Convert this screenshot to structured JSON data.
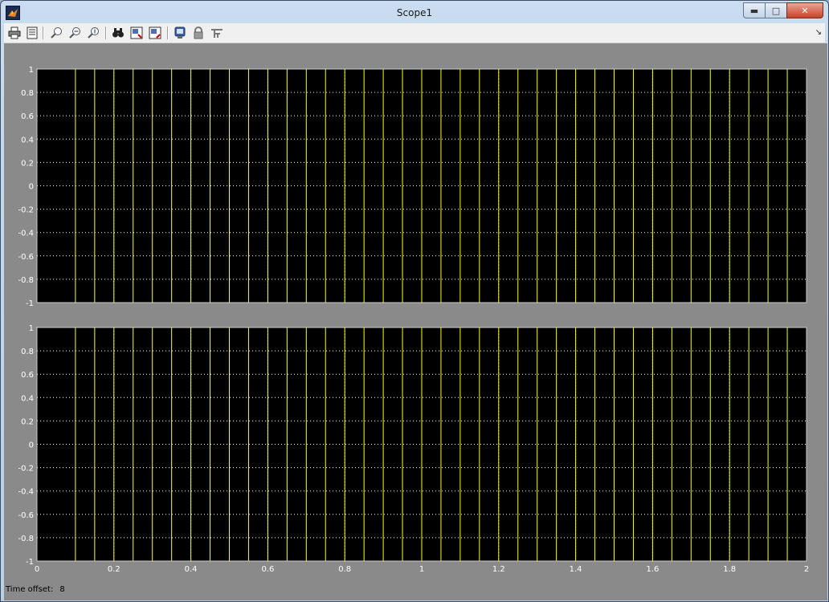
{
  "window": {
    "title": "Scope1"
  },
  "toolbar": {
    "icons": [
      "print-icon",
      "parameters-icon",
      "zoom-icon",
      "zoom-x-icon",
      "zoom-y-icon",
      "autoscale-icon",
      "save-axes-icon",
      "restore-axes-icon",
      "floating-scope-icon",
      "lock-axes-icon",
      "signal-selection-icon"
    ]
  },
  "status": {
    "label": "Time offset:",
    "value": "8"
  },
  "colors": {
    "background": "#8a8a8a",
    "axes": "#000000",
    "trace": "#ffff00",
    "grid": "#ffffff",
    "text": "#ffffff"
  },
  "chart_data": [
    {
      "type": "line",
      "step": true,
      "x": [
        0,
        0.1,
        0.15,
        0.2,
        0.25,
        0.3,
        0.35,
        0.4,
        0.45,
        0.5,
        0.55,
        0.6,
        0.65,
        0.7,
        0.75,
        0.8,
        0.85,
        0.9,
        0.95,
        1,
        1.05,
        1.1,
        1.15,
        1.2,
        1.25,
        1.3,
        1.35,
        1.4,
        1.45,
        1.5,
        1.55,
        1.6,
        1.65,
        1.7,
        1.75,
        1.8,
        1.85,
        1.9,
        1.95
      ],
      "y": [
        1,
        -1,
        1,
        -1,
        1,
        -1,
        1,
        -1,
        1,
        -1,
        1,
        -1,
        1,
        -1,
        1,
        -1,
        1,
        -1,
        1,
        -1,
        1,
        -1,
        1,
        -1,
        1,
        -1,
        1,
        -1,
        1,
        -1,
        1,
        -1,
        1,
        -1,
        1,
        -1,
        1,
        -1,
        1
      ],
      "xlim": [
        0,
        2
      ],
      "ylim": [
        -1,
        1
      ],
      "yticks": [
        "-1",
        "-0.8",
        "-0.6",
        "-0.4",
        "-0.2",
        "0",
        "0.2",
        "0.4",
        "0.6",
        "0.8",
        "1"
      ],
      "xticks": [],
      "grid": true
    },
    {
      "type": "line",
      "step": true,
      "x": [
        0,
        0.1,
        0.15,
        0.2,
        0.25,
        0.3,
        0.35,
        0.4,
        0.45,
        0.5,
        0.55,
        0.6,
        0.65,
        0.7,
        0.75,
        0.8,
        0.85,
        0.9,
        0.95,
        1,
        1.05,
        1.1,
        1.15,
        1.2,
        1.25,
        1.3,
        1.35,
        1.4,
        1.45,
        1.5,
        1.55,
        1.6,
        1.65,
        1.7,
        1.75,
        1.8,
        1.85,
        1.9,
        1.95
      ],
      "y": [
        1,
        -1,
        1,
        -1,
        1,
        -1,
        1,
        -1,
        1,
        -1,
        1,
        -1,
        1,
        -1,
        1,
        -1,
        1,
        -1,
        1,
        -1,
        1,
        -1,
        1,
        -1,
        1,
        -1,
        1,
        -1,
        1,
        -1,
        1,
        -1,
        1,
        -1,
        1,
        -1,
        1,
        -1,
        1
      ],
      "xlim": [
        0,
        2
      ],
      "ylim": [
        -1,
        1
      ],
      "yticks": [
        "-1",
        "-0.8",
        "-0.6",
        "-0.4",
        "-0.2",
        "0",
        "0.2",
        "0.4",
        "0.6",
        "0.8",
        "1"
      ],
      "xticks": [
        "0",
        "0.2",
        "0.4",
        "0.6",
        "0.8",
        "1",
        "1.2",
        "1.4",
        "1.6",
        "1.8",
        "2"
      ],
      "grid": true
    }
  ]
}
